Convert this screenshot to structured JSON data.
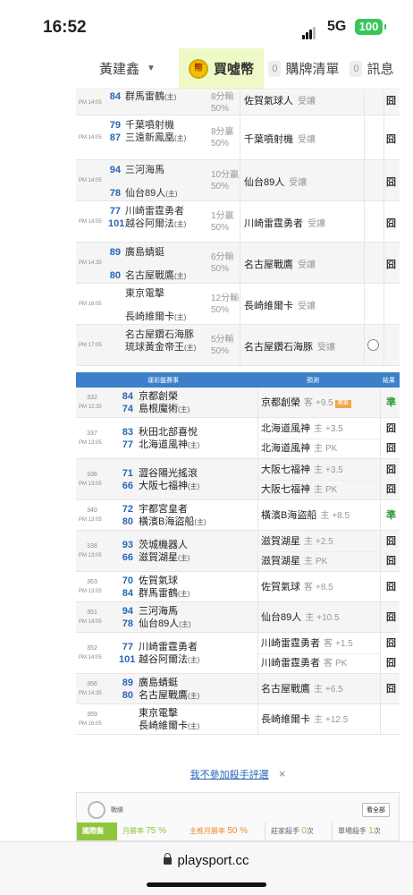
{
  "status": {
    "time": "16:52",
    "network": "5G",
    "battery": "100"
  },
  "tabs": {
    "user": "黃建鑫",
    "coin_icon_text": "幣",
    "coin_label": "買噓幣",
    "buy_count": "0",
    "buy_label": "購牌清單",
    "msg_count": "0",
    "msg_label": "訊息"
  },
  "top_rows": [
    {
      "time": "PM 14:05",
      "away_num": "84",
      "away": "群馬雷鶴",
      "away_h": "(主)",
      "home_num": "",
      "home": "",
      "home_h": "",
      "res1": "8分輸",
      "res2": "50%",
      "pick": "佐賀氣球人",
      "pick_sub": "受讓",
      "mark": "囧",
      "circle": false
    },
    {
      "time": "PM 14:05",
      "away_num": "79",
      "away": "千葉噴射機",
      "away_h": "",
      "home_num": "87",
      "home": "三遠新鳳凰",
      "home_h": "(主)",
      "res1": "8分贏",
      "res2": "50%",
      "pick": "千葉噴射機",
      "pick_sub": "受讓",
      "mark": "囧",
      "circle": false
    },
    {
      "time": "PM 14:05",
      "away_num": "94",
      "away": "三河海馬",
      "away_h": "",
      "home_num": "78",
      "home": "仙台89人",
      "home_h": "(主)",
      "res1": "10分贏",
      "res2": "50%",
      "pick": "仙台89人",
      "pick_sub": "受讓",
      "mark": "囧",
      "circle": false
    },
    {
      "time": "PM 14:05",
      "away_num": "77",
      "away": "川崎雷霆勇者",
      "away_h": "",
      "home_num": "101",
      "home": "越谷阿爾法",
      "home_h": "(主)",
      "res1": "1分贏",
      "res2": "50%",
      "pick": "川崎雷霆勇者",
      "pick_sub": "受讓",
      "mark": "囧",
      "circle": false
    },
    {
      "time": "PM 14:35",
      "away_num": "89",
      "away": "廣島蜻蜓",
      "away_h": "",
      "home_num": "80",
      "home": "名古屋戰鷹",
      "home_h": "(主)",
      "res1": "6分輸",
      "res2": "50%",
      "pick": "名古屋戰鷹",
      "pick_sub": "受讓",
      "mark": "囧",
      "circle": false
    },
    {
      "time": "PM 16:05",
      "away_num": "",
      "away": "東京電擊",
      "away_h": "",
      "home_num": "",
      "home": "長崎維爾卡",
      "home_h": "(主)",
      "res1": "12分輸",
      "res2": "50%",
      "pick": "長崎維爾卡",
      "pick_sub": "受讓",
      "mark": "",
      "circle": false
    },
    {
      "time": "PM 17:05",
      "away_num": "",
      "away": "名古屋鑽石海豚",
      "away_h": "",
      "home_num": "",
      "home": "琉球黃金帝王",
      "home_h": "(主)",
      "res1": "5分輸",
      "res2": "50%",
      "pick": "名古屋鑽石海豚",
      "pick_sub": "受讓",
      "mark": "",
      "circle": true
    }
  ],
  "section2": {
    "col_game": "運彩盤賽事",
    "col_pick": "預測",
    "col_result": "結果",
    "rows": [
      {
        "id": "332",
        "time": "PM 12:35",
        "away_num": "84",
        "away": "京都創榮",
        "home_num": "74",
        "home": "島根魔術",
        "home_h": "(主)",
        "picks": [
          {
            "team": "京都創榮",
            "side": "客",
            "line": "+9.5",
            "badge": "賽果",
            "mark": "準",
            "win": true
          }
        ]
      },
      {
        "id": "337",
        "time": "PM 13:05",
        "away_num": "83",
        "away": "秋田北部喜悅",
        "home_num": "77",
        "home": "北海道風神",
        "home_h": "(主)",
        "picks": [
          {
            "team": "北海道風神",
            "side": "主",
            "line": "+3.5",
            "badge": "",
            "mark": "囧",
            "win": false
          },
          {
            "team": "北海道風神",
            "side": "主",
            "line": "PK",
            "badge": "",
            "mark": "囧",
            "win": false
          }
        ]
      },
      {
        "id": "336",
        "time": "PM 13:05",
        "away_num": "71",
        "away": "澀谷陽光搖滾",
        "home_num": "66",
        "home": "大阪七福神",
        "home_h": "(主)",
        "picks": [
          {
            "team": "大阪七福神",
            "side": "主",
            "line": "+3.5",
            "badge": "",
            "mark": "囧",
            "win": false
          },
          {
            "team": "大阪七福神",
            "side": "主",
            "line": "PK",
            "badge": "",
            "mark": "囧",
            "win": false
          }
        ]
      },
      {
        "id": "340",
        "time": "PM 13:05",
        "away_num": "72",
        "away": "宇都宮皇者",
        "home_num": "80",
        "home": "橫濱B海盜船",
        "home_h": "(主)",
        "picks": [
          {
            "team": "橫濱B海盜船",
            "side": "主",
            "line": "+8.5",
            "badge": "",
            "mark": "準",
            "win": true
          }
        ]
      },
      {
        "id": "338",
        "time": "PM 13:05",
        "away_num": "93",
        "away": "茨城機器人",
        "home_num": "66",
        "home": "滋賀湖星",
        "home_h": "(主)",
        "picks": [
          {
            "team": "滋賀湖星",
            "side": "主",
            "line": "+2.5",
            "badge": "",
            "mark": "囧",
            "win": false
          },
          {
            "team": "滋賀湖星",
            "side": "主",
            "line": "PK",
            "badge": "",
            "mark": "囧",
            "win": false
          }
        ]
      },
      {
        "id": "353",
        "time": "PM 13:05",
        "away_num": "70",
        "away": "佐賀氣球",
        "home_num": "84",
        "home": "群馬雷鶴",
        "home_h": "(主)",
        "picks": [
          {
            "team": "佐賀氣球",
            "side": "客",
            "line": "+8.5",
            "badge": "",
            "mark": "囧",
            "win": false
          }
        ]
      },
      {
        "id": "351",
        "time": "PM 14:05",
        "away_num": "94",
        "away": "三河海馬",
        "home_num": "78",
        "home": "仙台89人",
        "home_h": "(主)",
        "picks": [
          {
            "team": "仙台89人",
            "side": "主",
            "line": "+10.5",
            "badge": "",
            "mark": "囧",
            "win": false
          }
        ]
      },
      {
        "id": "352",
        "time": "PM 14:05",
        "away_num": "77",
        "away": "川崎雷霆勇者",
        "home_num": "101",
        "home": "越谷阿爾法",
        "home_h": "(主)",
        "picks": [
          {
            "team": "川崎雷霆勇者",
            "side": "客",
            "line": "+1.5",
            "badge": "",
            "mark": "囧",
            "win": false
          },
          {
            "team": "川崎雷霆勇者",
            "side": "客",
            "line": "PK",
            "badge": "",
            "mark": "囧",
            "win": false
          }
        ]
      },
      {
        "id": "356",
        "time": "PM 14:35",
        "away_num": "89",
        "away": "廣島蜻蜓",
        "home_num": "80",
        "home": "名古屋戰鷹",
        "home_h": "(主)",
        "picks": [
          {
            "team": "名古屋戰鷹",
            "side": "主",
            "line": "+6.5",
            "badge": "",
            "mark": "囧",
            "win": false
          }
        ]
      },
      {
        "id": "359",
        "time": "PM 16:05",
        "away_num": "",
        "away": "東京電擊",
        "home_num": "",
        "home": "長崎維爾卡",
        "home_h": "(主)",
        "picks": [
          {
            "team": "長崎維爾卡",
            "side": "主",
            "line": "+12.5",
            "badge": "",
            "mark": "",
            "win": false
          }
        ]
      }
    ]
  },
  "not_join_link": "我不參加殺手評選",
  "not_join_close": "×",
  "stats": {
    "title": "戰績",
    "view_all": "看全部",
    "tab": "國際盤",
    "month_win_label": "月勝率",
    "month_win": "75 %",
    "home_push_label": "主推月勝率",
    "home_push": "50 %",
    "killer_label": "莊家殺手",
    "killer": "0",
    "killer_unit": "次",
    "single_label": "單場殺手",
    "single": "1",
    "single_unit": "次"
  },
  "browser": {
    "url": "playsport.cc"
  }
}
